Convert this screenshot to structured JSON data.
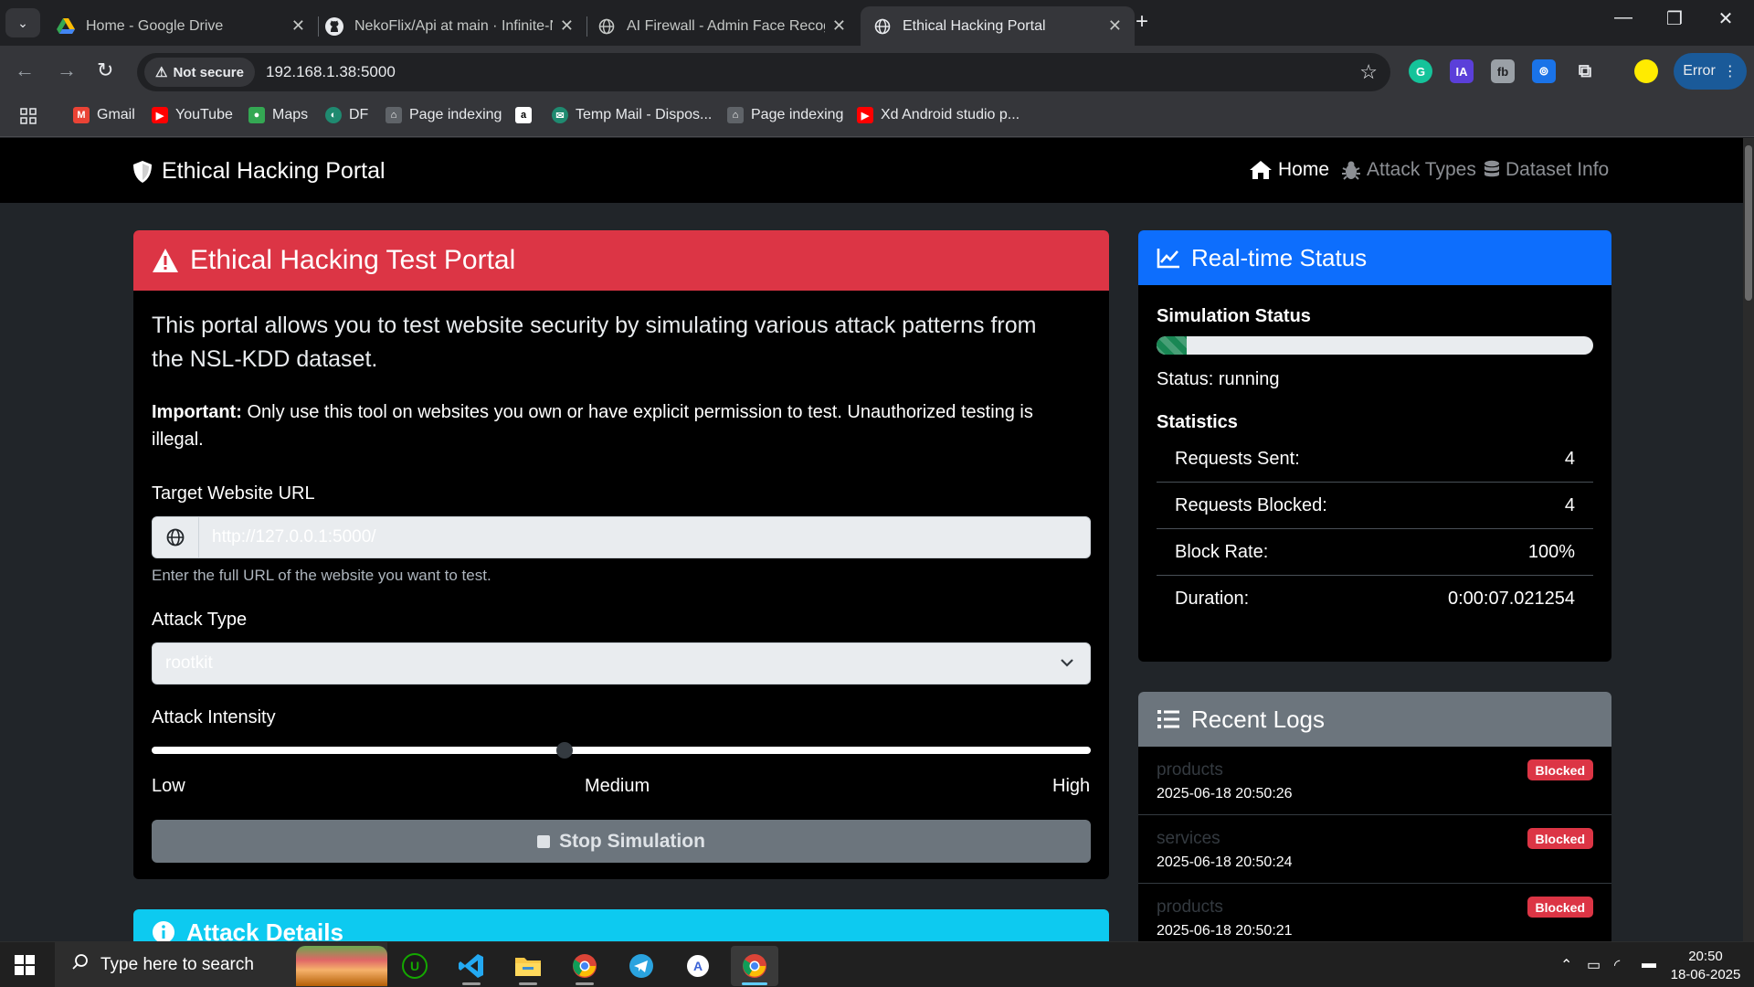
{
  "browser": {
    "tabs": [
      {
        "title": "Home - Google Drive",
        "icon": "google-drive-icon"
      },
      {
        "title": "NekoFlix/Api at main · Infinite-N",
        "icon": "github-icon"
      },
      {
        "title": "AI Firewall - Admin Face Recogn",
        "icon": "globe-icon"
      },
      {
        "title": "Ethical Hacking Portal",
        "icon": "globe-icon",
        "active": true
      }
    ],
    "not_secure": "Not secure",
    "url": "192.168.1.38:5000",
    "profile_label": "Error",
    "extensions": [
      "G",
      "IA",
      "fb",
      "⊚"
    ],
    "bookmarks": [
      "Gmail",
      "YouTube",
      "Maps",
      "DF",
      "Page indexing",
      "a",
      "Temp Mail - Dispos...",
      "Page indexing",
      "Xd Android studio p..."
    ]
  },
  "site": {
    "brand": "Ethical Hacking Portal",
    "nav": [
      {
        "label": "Home",
        "active": true
      },
      {
        "label": "Attack Types"
      },
      {
        "label": "Dataset Info"
      }
    ]
  },
  "test_card": {
    "title": "Ethical Hacking Test Portal",
    "lead": "This portal allows you to test website security by simulating various attack patterns from the NSL-KDD dataset.",
    "important_label": "Important:",
    "important_text": " Only use this tool on websites you own or have explicit permission to test. Unauthorized testing is illegal.",
    "url_label": "Target Website URL",
    "url_placeholder": "http://127.0.0.1:5000/",
    "url_help": "Enter the full URL of the website you want to test.",
    "attack_type_label": "Attack Type",
    "attack_type_value": "rootkit",
    "intensity_label": "Attack Intensity",
    "intensity_value_fraction": 0.44,
    "intensity_low": "Low",
    "intensity_medium": "Medium",
    "intensity_high": "High",
    "stop_button": "Stop Simulation"
  },
  "details_card": {
    "title": "Attack Details"
  },
  "status_card": {
    "title": "Real-time Status",
    "sim_status_label": "Simulation Status",
    "progress_fraction": 0.07,
    "status_text": "Status: running",
    "stats_label": "Statistics",
    "stats": [
      {
        "label": "Requests Sent:",
        "value": "4"
      },
      {
        "label": "Requests Blocked:",
        "value": "4"
      },
      {
        "label": "Block Rate:",
        "value": "100%"
      },
      {
        "label": "Duration:",
        "value": "0:00:07.021254"
      }
    ]
  },
  "logs_card": {
    "title": "Recent Logs",
    "items": [
      {
        "name": "products",
        "time": "2025-06-18 20:50:26",
        "badge": "Blocked"
      },
      {
        "name": "services",
        "time": "2025-06-18 20:50:24",
        "badge": "Blocked"
      },
      {
        "name": "products",
        "time": "2025-06-18 20:50:21",
        "badge": "Blocked"
      }
    ]
  },
  "taskbar": {
    "search_placeholder": "Type here to search",
    "time": "20:50",
    "date": "18-06-2025"
  },
  "colors": {
    "danger": "#dc3545",
    "primary": "#0d6efd",
    "secondary": "#6c757d",
    "info": "#0dcaf0",
    "success": "#198754"
  }
}
